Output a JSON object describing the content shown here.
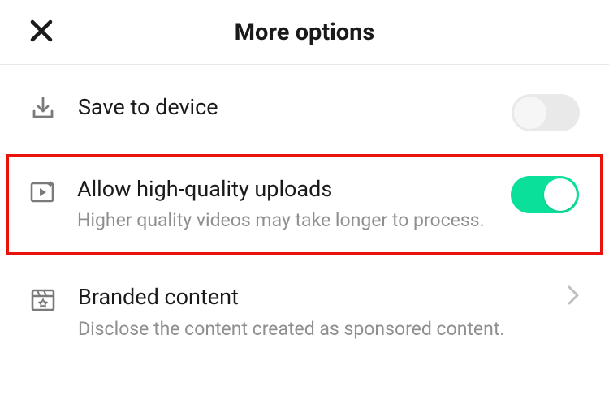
{
  "header": {
    "title": "More options"
  },
  "rows": {
    "save": {
      "label": "Save to device",
      "toggle_on": false
    },
    "hq": {
      "label": "Allow high-quality uploads",
      "sub": "Higher quality videos may take longer to process.",
      "toggle_on": true
    },
    "branded": {
      "label": "Branded content",
      "sub": "Disclose the content created as sponsored content."
    }
  }
}
